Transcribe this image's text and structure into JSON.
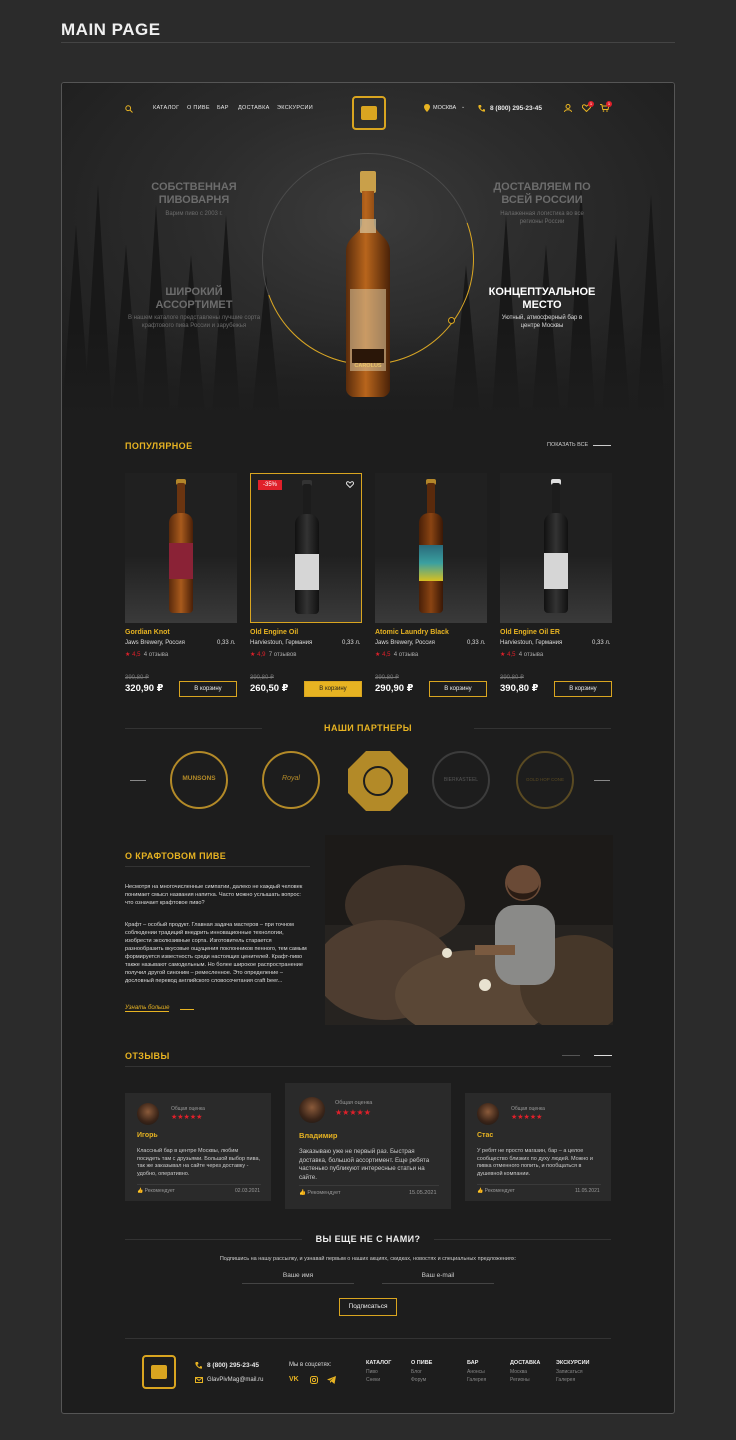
{
  "page_heading": "MAIN PAGE",
  "header": {
    "nav": [
      "КАТАЛОГ",
      "О ПИВЕ",
      "БАР",
      "ДОСТАВКА",
      "ЭКСКУРСИИ"
    ],
    "city": "МОСКВА",
    "phone": "8 (800) 295-23-45",
    "wishlist_count": "1",
    "cart_count": "1"
  },
  "hero": {
    "feature1_title": "СОБСТВЕННАЯ ПИВОВАРНЯ",
    "feature1_sub": "Варим пиво с 2003 г.",
    "feature2_title": "ДОСТАВЛЯЕМ ПО ВСЕЙ РОССИИ",
    "feature2_sub": "Налаженная логистика во все регионы России",
    "feature3_title": "ШИРОКИЙ АССОРТИМЕТ",
    "feature3_sub": "В нашем каталоге представлены лучшие сорта крафтового пива России и зарубежья",
    "feature4_title": "КОНЦЕПТУАЛЬНОЕ МЕСТО",
    "feature4_sub": "Уютный, атмосферный бар в центре Москвы",
    "bottle_label": "CAROLUS"
  },
  "popular": {
    "title": "ПОПУЛЯРНОЕ",
    "show_all": "ПОКАЗАТЬ ВСЕ",
    "discount_badge": "-35%",
    "products": [
      {
        "name": "Gordian Knot",
        "brewery": "Jaws Brewery, Россия",
        "volume": "0,33 л.",
        "rating": "4,5",
        "reviews": "4 отзыва",
        "old_price": "390,80 ₽",
        "price": "320,90 ₽",
        "button": "В корзину"
      },
      {
        "name": "Old Engine Oil",
        "brewery": "Harviestoun, Германия",
        "volume": "0,33 л.",
        "rating": "4,9",
        "reviews": "7 отзывов",
        "old_price": "390,80 ₽",
        "price": "260,50 ₽",
        "button": "В корзину"
      },
      {
        "name": "Atomic Laundry Black",
        "brewery": "Jaws Brewery, Россия",
        "volume": "0,33 л.",
        "rating": "4,5",
        "reviews": "4 отзыва",
        "old_price": "390,80 ₽",
        "price": "290,90 ₽",
        "button": "В корзину"
      },
      {
        "name": "Old Engine Oil ER",
        "brewery": "Harviestoun, Германия",
        "volume": "0,33 л.",
        "rating": "4,5",
        "reviews": "4 отзыва",
        "old_price": "390,80 ₽",
        "price": "390,80 ₽",
        "button": "В корзину"
      }
    ]
  },
  "partners": {
    "title": "НАШИ ПАРТНЕРЫ",
    "names": [
      "MUNSONS",
      "Royal",
      "",
      "BIERKASTEEL",
      "GOLD HOP CONE"
    ]
  },
  "about": {
    "title": "О КРАФТОВОМ ПИВЕ",
    "p1": "Несмотря на многочисленные симпатии, далеко не каждый человек понимает смысл названия напитка. Часто можно услышать вопрос: что означает крафтовое пиво?",
    "p2": "Крафт – особый продукт. Главная задача мастеров – при точном соблюдении традиций внедрить инновационные технологии, изобрести эксклюзивные сорта. Изготовитель старается разнообразить вкусовые ощущения поклонников пенного, тем самым формируется известность среди настоящих ценителей. Крафт-пиво также называют самодельным. Но более широкое распространение получил другой синоним – ремесленное. Это определение – дословный перевод английского словосочетания craft beer...",
    "more": "Узнать больше"
  },
  "reviews": {
    "title": "ОТЗЫВЫ",
    "rating_label": "Общая оценка",
    "items": [
      {
        "name": "Игорь",
        "text": "Классный бар в центре Москвы, любим посидеть там с друзьями. Большой выбор пива, так же заказывал на сайте через доставку - удобно, оперативно.",
        "recommend": "Рекомендует",
        "date": "02.03.2021"
      },
      {
        "name": "Владимир",
        "text": "Заказываю уже не первый раз. Быстрая доставка, большой ассортимент. Еще ребята частенько публикуют интересные статьи на сайте.",
        "recommend": "Рекомендует",
        "date": "15.05.2021"
      },
      {
        "name": "Стас",
        "text": "У ребят не просто магазин, бар – а целое сообщество близких по духу людей. Можно и пивка отменного попить, и пообщаться в душевной компании.",
        "recommend": "Рекомендует",
        "date": "11.05.2021"
      }
    ]
  },
  "subscribe": {
    "title": "ВЫ ЕЩЕ НЕ С НАМИ?",
    "text": "Подпишись на нашу рассылку, и узнавай первым о наших акциях, скидках, новостях и специальных предложениях:",
    "name_placeholder": "Ваше имя",
    "email_placeholder": "Ваш e-mail",
    "button": "Подписаться"
  },
  "footer": {
    "phone": "8 (800) 295-23-45",
    "email": "GlavPivMag@mail.ru",
    "social_label": "Мы в соцсетях:",
    "columns": [
      {
        "title": "КАТАЛОГ",
        "links": [
          "Пиво",
          "Снеки"
        ]
      },
      {
        "title": "О ПИВЕ",
        "links": [
          "Блог",
          "Форум"
        ]
      },
      {
        "title": "БАР",
        "links": [
          "Анонсы",
          "Галерея"
        ]
      },
      {
        "title": "ДОСТАВКА",
        "links": [
          "Москва",
          "Регионы"
        ]
      },
      {
        "title": "ЭКСКУРСИИ",
        "links": [
          "Записаться",
          "Галерея"
        ]
      }
    ]
  },
  "colors": {
    "accent": "#e7b322",
    "sale": "#e0202a",
    "background": "#1d1d1d"
  }
}
